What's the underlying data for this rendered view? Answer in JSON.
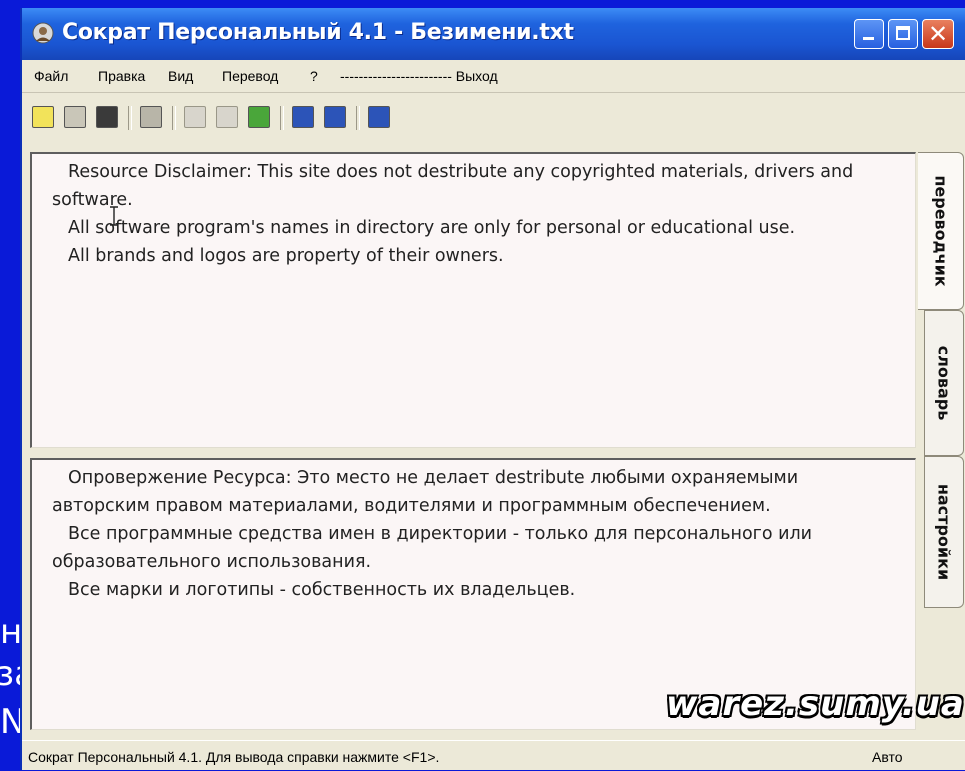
{
  "background_fragments": [
    "н",
    "за",
    "N"
  ],
  "window": {
    "title": "Сократ Персональный 4.1 - Безимени.txt",
    "title_color": "#1f5fde"
  },
  "menu": {
    "items": [
      "Файл",
      "Правка",
      "Вид",
      "Перевод",
      "?",
      "------------------------ Выход"
    ]
  },
  "toolbar": {
    "buttons": [
      {
        "icon": "new-document-icon",
        "color": "#f2e35a"
      },
      {
        "icon": "open-folder-icon",
        "color": "#c9c6b8"
      },
      {
        "icon": "save-icon",
        "color": "#3a3a3a"
      },
      {
        "icon": "print-icon",
        "color": "#b8b5a8"
      },
      {
        "icon": "user-icon",
        "color": "#d8d5cc"
      },
      {
        "icon": "copy-icon",
        "color": "#d8d5cc"
      },
      {
        "icon": "green-tool-icon",
        "color": "#4aa63a"
      },
      {
        "icon": "arrow-down-blue-icon",
        "color": "#2c54b8"
      },
      {
        "icon": "arrow-up-blue-icon",
        "color": "#2c54b8"
      },
      {
        "icon": "info-icon",
        "color": "#2c54b8"
      }
    ]
  },
  "source_text": {
    "paragraphs": [
      "Resource Disclaimer: This site does not destribute any copyrighted materials, drivers and software.",
      "All software program's names in directory are only for personal or educational use.",
      "All brands and logos are property of their owners."
    ]
  },
  "translated_text": {
    "paragraphs": [
      "Опровержение Ресурса: Это место не делает destribute любыми охраняемыми авторским правом материалами, водителями и программным обеспечением.",
      "Все программные средства имен в директории - только для персонального или образовательного использования.",
      "Все марки и логотипы - собственность их владельцев."
    ]
  },
  "tabs": [
    "переводчик",
    "словарь",
    "настройки"
  ],
  "status": {
    "text": "Сократ Персональный  4.1.  Для вывода справки нажмите <F1>.",
    "mode": "Авто"
  },
  "watermark": "warez.sumy.ua"
}
